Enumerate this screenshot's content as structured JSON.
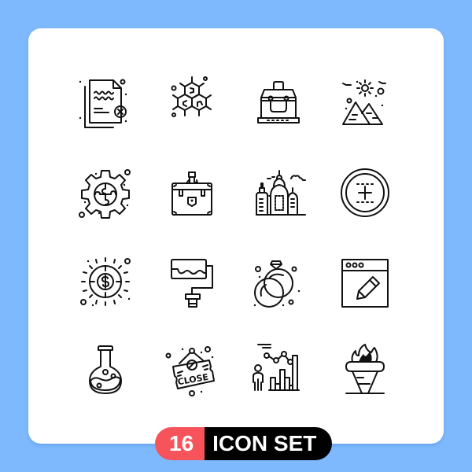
{
  "colors": {
    "background": "#7db9fc",
    "card": "#ffffff",
    "stroke": "#111111",
    "badge_number_bg": "#f7535b",
    "badge_label_bg": "#000000"
  },
  "icons": [
    {
      "name": "document-cancel-icon"
    },
    {
      "name": "molecule-hexagon-icon"
    },
    {
      "name": "toolbox-icon"
    },
    {
      "name": "pyramids-icon"
    },
    {
      "name": "gear-puzzle-icon"
    },
    {
      "name": "briefcase-tool-icon"
    },
    {
      "name": "city-buildings-icon"
    },
    {
      "name": "add-circle-dotted-icon"
    },
    {
      "name": "dollar-coin-icon"
    },
    {
      "name": "paint-roller-icon"
    },
    {
      "name": "wedding-rings-icon"
    },
    {
      "name": "browser-edit-icon"
    },
    {
      "name": "flask-icon"
    },
    {
      "name": "coffee-close-sign-icon",
      "text": "CLOSE"
    },
    {
      "name": "person-chart-icon"
    },
    {
      "name": "torch-icon"
    }
  ],
  "badge": {
    "number": "16",
    "label": "ICON SET"
  }
}
